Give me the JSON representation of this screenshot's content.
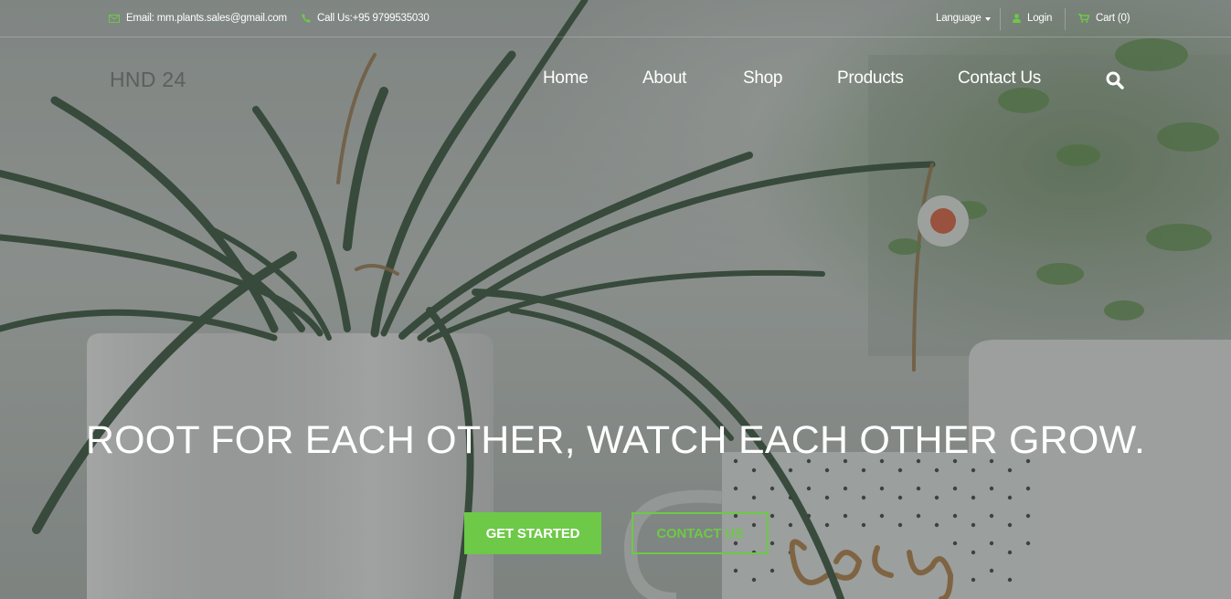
{
  "topbar": {
    "email": "Email: mm.plants.sales@gmail.com",
    "phone": "Call Us:+95 9799535030",
    "language": "Language",
    "login": "Login",
    "cart": "Cart (0)"
  },
  "brand": {
    "logo": "HND 24"
  },
  "nav": {
    "items": [
      "Home",
      "About",
      "Shop",
      "Products",
      "Contact Us"
    ]
  },
  "hero": {
    "headline": "ROOT FOR EACH OTHER, WATCH EACH OTHER GROW.",
    "cta_primary": "GET STARTED",
    "cta_secondary": "CONTACT US"
  },
  "icons": {
    "email": "envelope-icon",
    "phone": "phone-icon",
    "login": "user-icon",
    "cart": "cart-icon",
    "search": "search-icon"
  },
  "colors": {
    "accent": "#6dc947",
    "text_light": "#ffffff",
    "logo": "#5b5f5d"
  }
}
